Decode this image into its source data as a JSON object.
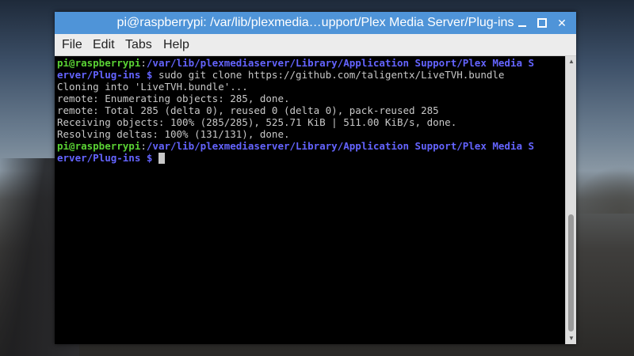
{
  "window": {
    "title": "pi@raspberrypi: /var/lib/plexmedia…upport/Plex Media Server/Plug-ins",
    "minimize_glyph": "",
    "maximize_glyph": "",
    "close_glyph": "✕"
  },
  "menu": {
    "file": "File",
    "edit": "Edit",
    "tabs": "Tabs",
    "help": "Help"
  },
  "terminal": {
    "lines": [
      {
        "user": "pi@raspberrypi",
        "sep": ":",
        "path": "/var/lib/plexmediaserver/Library/Application Support/Plex Media S",
        "text": ""
      },
      {
        "user": "",
        "sep": "",
        "path": "erver/Plug-ins $",
        "text": " sudo git clone https://github.com/taligentx/LiveTVH.bundle"
      },
      {
        "user": "",
        "sep": "",
        "path": "",
        "text": "Cloning into 'LiveTVH.bundle'..."
      },
      {
        "user": "",
        "sep": "",
        "path": "",
        "text": "remote: Enumerating objects: 285, done."
      },
      {
        "user": "",
        "sep": "",
        "path": "",
        "text": "remote: Total 285 (delta 0), reused 0 (delta 0), pack-reused 285"
      },
      {
        "user": "",
        "sep": "",
        "path": "",
        "text": "Receiving objects: 100% (285/285), 525.71 KiB | 511.00 KiB/s, done."
      },
      {
        "user": "",
        "sep": "",
        "path": "",
        "text": "Resolving deltas: 100% (131/131), done."
      },
      {
        "user": "pi@raspberrypi",
        "sep": ":",
        "path": "/var/lib/plexmediaserver/Library/Application Support/Plex Media S",
        "text": ""
      },
      {
        "user": "",
        "sep": "",
        "path": "erver/Plug-ins $",
        "text": " "
      }
    ]
  },
  "colors": {
    "titlebar": "#4f94d8",
    "prompt_user": "#5ad234",
    "prompt_path": "#6464ff",
    "terminal_bg": "#000000",
    "terminal_fg": "#c8c8c8"
  },
  "scrollbar": {
    "up_glyph": "▲",
    "down_glyph": "▼"
  }
}
